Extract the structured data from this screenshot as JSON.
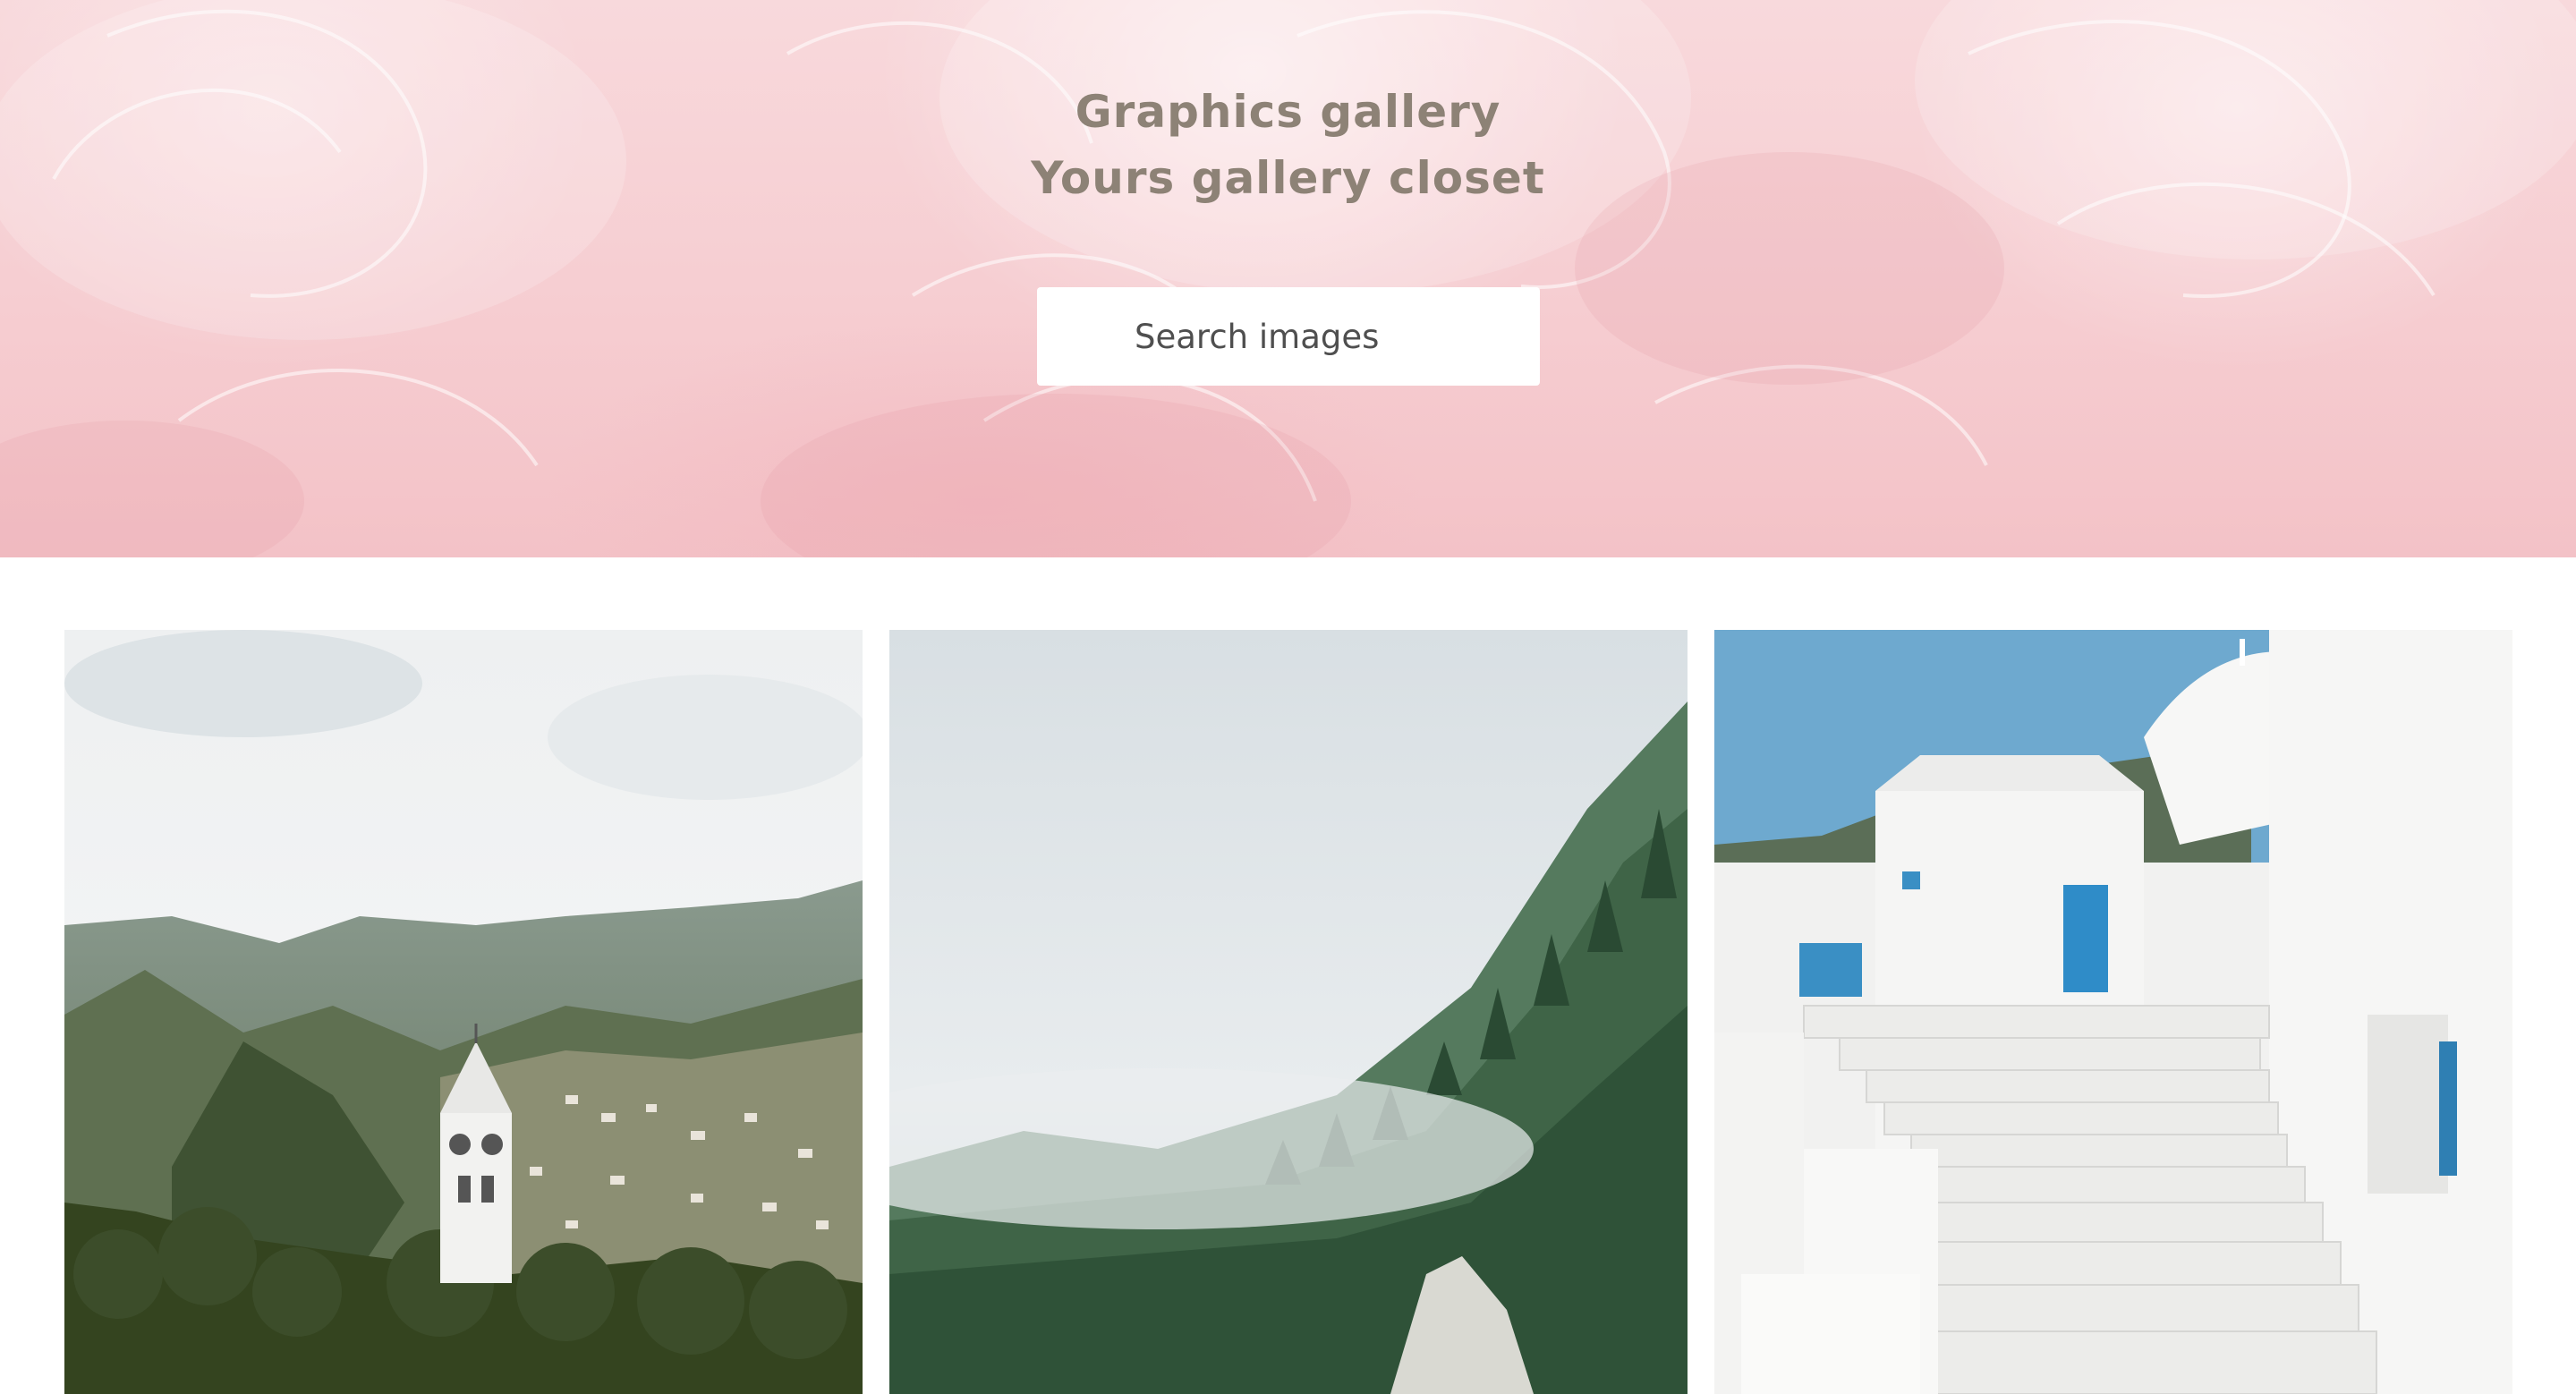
{
  "hero": {
    "title": "Graphics gallery",
    "subtitle": "Yours gallery closet",
    "background_color": "#f6cdd1"
  },
  "search": {
    "placeholder": "Search images",
    "value": ""
  },
  "gallery": {
    "items": [
      {
        "subject": "church-tower-mountains",
        "dominant_color": "#4a5a3a"
      },
      {
        "subject": "misty-forest-mountainside",
        "dominant_color": "#2f4a3a"
      },
      {
        "subject": "white-stairs-blue-doors",
        "dominant_color": "#f2f2f2"
      }
    ]
  },
  "colors": {
    "heading_text": "#8d8276",
    "search_text": "#4f4f4f"
  }
}
